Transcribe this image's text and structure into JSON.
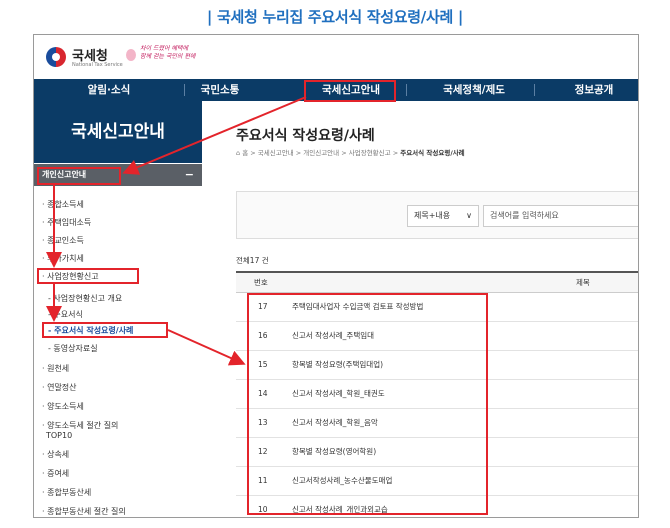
{
  "caption": "| 국세청 누리집 주요서식 작성요령/사례 |",
  "logo": {
    "name": "국세청",
    "sub": "National Tax Service",
    "slogan_line1": "차이 드렸어 혜택에",
    "slogan_line2": "함께 걷는 국민의 편에"
  },
  "nav": {
    "items": [
      "알림·소식",
      "국민소통",
      "국세신고안내",
      "국세정책/제도",
      "정보공개"
    ]
  },
  "sidebar": {
    "title": "국세신고안내",
    "section": "개인신고안내",
    "toggle": "−",
    "items": [
      {
        "label": "· 종합소득세"
      },
      {
        "label": "· 주택임대소득"
      },
      {
        "label": "· 종교인소득"
      },
      {
        "label": "· 부가가치세"
      },
      {
        "label": "· 사업장현황신고"
      },
      {
        "label": "- 사업장현황신고 개요"
      },
      {
        "label": "- 주요서식"
      },
      {
        "label": "- 주요서식 작성요령/사례"
      },
      {
        "label": "- 동영상자료실"
      },
      {
        "label": "· 원천세"
      },
      {
        "label": "· 연말정산"
      },
      {
        "label": "· 양도소득세"
      },
      {
        "label": "· 양도소득세 절간 질의"
      },
      {
        "label": "TOP10"
      },
      {
        "label": "· 상속세"
      },
      {
        "label": "· 증여세"
      },
      {
        "label": "· 종합부동산세"
      },
      {
        "label": "· 종합부동산세 절간 질의"
      }
    ]
  },
  "content": {
    "title": "주요서식 작성요령/사례",
    "breadcrumb": [
      "⌂ 홈",
      "국세신고안내",
      "개인신고안내",
      "사업장현황신고"
    ],
    "breadcrumb_current": "주요서식 작성요령/사례",
    "breadcrumb_sep": " > ",
    "search": {
      "select_value": "제목+내용",
      "placeholder": "검색어를 입력하세요"
    },
    "total": "전체17 건",
    "table": {
      "headers": [
        "번호",
        "제목"
      ],
      "rows": [
        {
          "no": "17",
          "title": "주택임대사업자 수입금액 검토표 작성방법"
        },
        {
          "no": "16",
          "title": "신고서 작성사례_주택임대"
        },
        {
          "no": "15",
          "title": "항목별 작성요령(주택임대업)"
        },
        {
          "no": "14",
          "title": "신고서 작성사례_학원_태권도"
        },
        {
          "no": "13",
          "title": "신고서 작성사례_학원_음악"
        },
        {
          "no": "12",
          "title": "항목별 작성요령(영어학원)"
        },
        {
          "no": "11",
          "title": "신고서작성사례_농수산물도매업"
        },
        {
          "no": "10",
          "title": "신고서 작성사례_개인과외교습"
        }
      ]
    }
  },
  "colors": {
    "caption": "#1f6fbf",
    "nav_bg": "#0b3b66",
    "highlight": "#e3242b",
    "sub_head_bg": "#5a5f66"
  }
}
